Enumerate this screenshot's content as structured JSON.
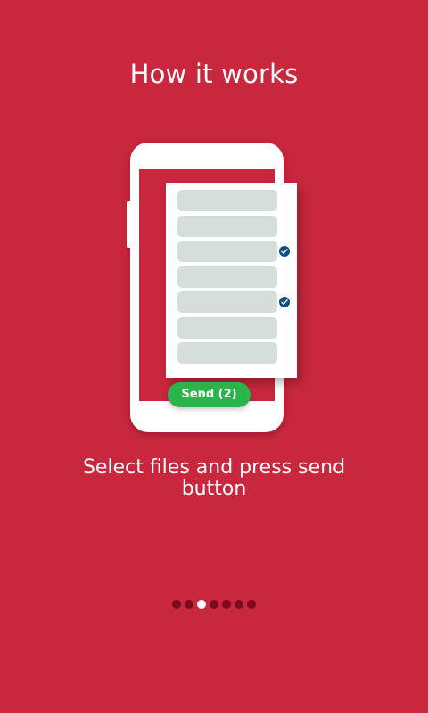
{
  "header": {
    "title": "How it works"
  },
  "illustration": {
    "rows": [
      {
        "checked": false
      },
      {
        "checked": false
      },
      {
        "checked": true
      },
      {
        "checked": false
      },
      {
        "checked": true
      },
      {
        "checked": false
      },
      {
        "checked": false
      }
    ],
    "send_label": "Send (2)"
  },
  "caption": "Select files and press send button",
  "pager": {
    "count": 7,
    "active_index": 2
  },
  "colors": {
    "background": "#c9273d",
    "send": "#2ab54a",
    "check": "#0f4c8a",
    "row": "#d5dedb",
    "dot": "#7c0b1c",
    "dot_active": "#ffffff"
  }
}
